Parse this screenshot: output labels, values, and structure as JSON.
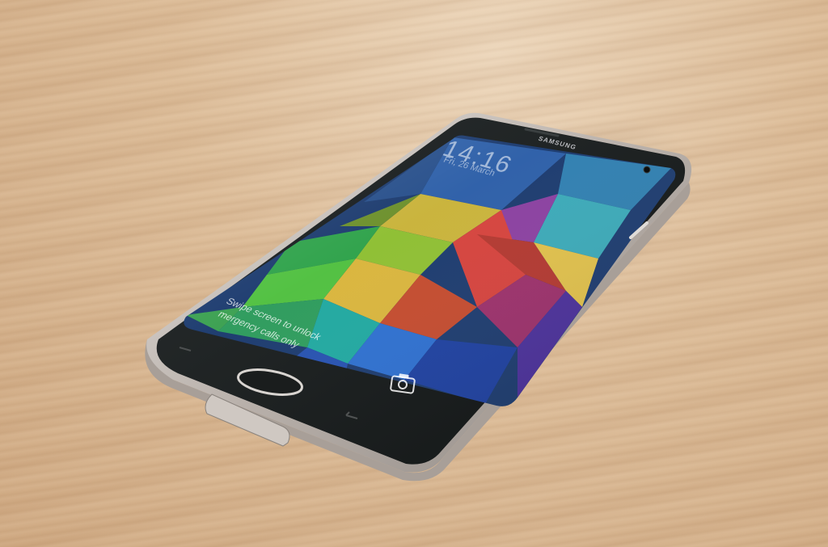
{
  "scene": {
    "description_colors": {
      "wood_light": "#ecd6bb",
      "wood_mid": "#dcbc98",
      "wood_dark": "#cfa982",
      "phone_body": "#1c2020",
      "phone_frame": "#c9c2bd"
    }
  },
  "phone": {
    "brand": "SAMSUNG",
    "lock_screen": {
      "clock": "14:16",
      "date": "Fri, 26 March",
      "unlock_hint": "Swipe screen to unlock",
      "emergency_hint": "mergency calls only"
    },
    "icons": [
      "camera-icon",
      "home-button",
      "back-icon",
      "recent-apps-icon"
    ]
  }
}
